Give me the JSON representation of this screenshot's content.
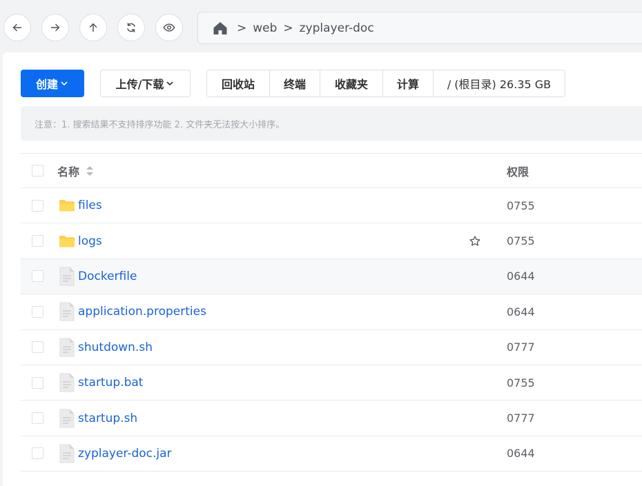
{
  "breadcrumb": {
    "separator": ">",
    "items": [
      "web",
      "zyplayer-doc"
    ]
  },
  "toolbar": {
    "create_label": "创建",
    "upload_label": "上传/下载",
    "group": [
      "回收站",
      "终端",
      "收藏夹",
      "计算",
      "/ (根目录) 26.35 GB"
    ]
  },
  "notice": "注意：1. 搜索结果不支持排序功能 2. 文件夹无法按大小排序。",
  "table": {
    "headers": {
      "name": "名称",
      "permission": "权限"
    },
    "rows": [
      {
        "name": "files",
        "type": "folder",
        "permission": "0755"
      },
      {
        "name": "logs",
        "type": "folder",
        "permission": "0755",
        "star": true
      },
      {
        "name": "Dockerfile",
        "type": "file",
        "permission": "0644",
        "hover": true
      },
      {
        "name": "application.properties",
        "type": "file",
        "permission": "0644"
      },
      {
        "name": "shutdown.sh",
        "type": "file",
        "permission": "0777"
      },
      {
        "name": "startup.bat",
        "type": "file",
        "permission": "0755"
      },
      {
        "name": "startup.sh",
        "type": "file",
        "permission": "0777"
      },
      {
        "name": "zyplayer-doc.jar",
        "type": "file",
        "permission": "0644"
      }
    ]
  },
  "colors": {
    "accent": "#0b6cf2",
    "link": "#1b62d6",
    "folder": "#fccf47"
  },
  "icons": {
    "nav": [
      "arrow-left-icon",
      "arrow-right-icon",
      "arrow-up-icon",
      "refresh-icon",
      "eye-icon"
    ],
    "home": "home-icon",
    "sort": "sort-icon",
    "folder": "folder-icon",
    "file": "file-icon",
    "star": "star-icon"
  }
}
